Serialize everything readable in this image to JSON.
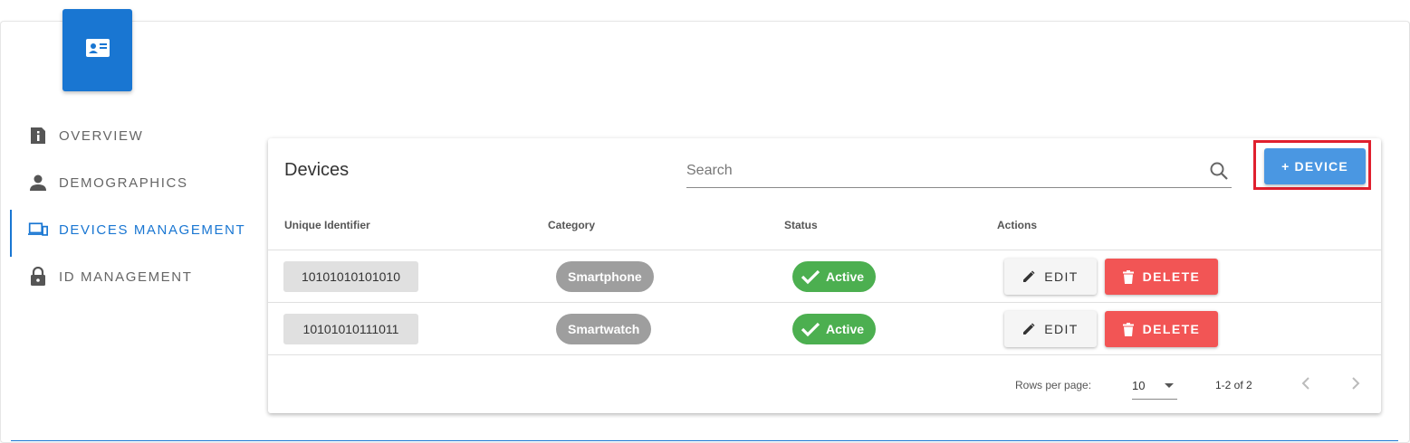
{
  "sidebar": {
    "items": [
      {
        "label": "OVERVIEW",
        "icon": "overview-info-icon"
      },
      {
        "label": "DEMOGRAPHICS",
        "icon": "person-icon"
      },
      {
        "label": "DEVICES MANAGEMENT",
        "icon": "devices-icon",
        "active": true
      },
      {
        "label": "ID MANAGEMENT",
        "icon": "lock-icon"
      }
    ]
  },
  "header_badge": {
    "icon": "id-card-icon"
  },
  "devices": {
    "title": "Devices",
    "search_placeholder": "Search",
    "add_button_label": "+ DEVICE",
    "columns": [
      "Unique Identifier",
      "Category",
      "Status",
      "Actions"
    ],
    "rows": [
      {
        "id": "10101010101010",
        "category": "Smartphone",
        "status": "Active",
        "edit_label": "EDIT",
        "delete_label": "DELETE"
      },
      {
        "id": "10101010111011",
        "category": "Smartwatch",
        "status": "Active",
        "edit_label": "EDIT",
        "delete_label": "DELETE"
      }
    ],
    "pagination": {
      "rows_per_page_label": "Rows per page:",
      "rows_per_page": "10",
      "range": "1-2 of 2"
    }
  },
  "colors": {
    "primary": "#1976d2",
    "add_button": "#4a97e2",
    "highlight": "#e0202e",
    "status_active": "#4caf50",
    "category_chip": "#9e9e9e",
    "delete": "#f25555"
  }
}
